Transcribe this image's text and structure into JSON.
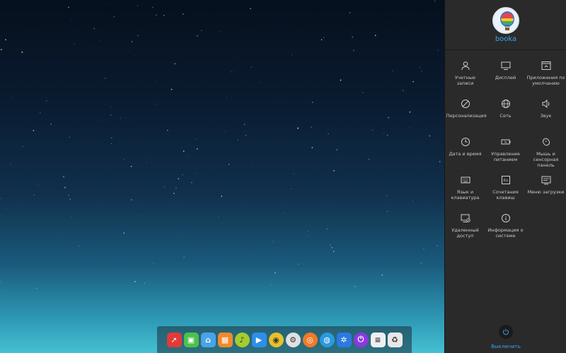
{
  "user": {
    "name": "booka"
  },
  "settings_items": [
    {
      "id": "accounts",
      "label": "Учетные записи",
      "icon": "user-icon"
    },
    {
      "id": "display",
      "label": "Дисплей",
      "icon": "monitor-icon"
    },
    {
      "id": "default-apps",
      "label": "Приложения по умолчанию",
      "icon": "default-apps-icon"
    },
    {
      "id": "personalization",
      "label": "Персонализация",
      "icon": "palette-icon"
    },
    {
      "id": "network",
      "label": "Сеть",
      "icon": "globe-icon"
    },
    {
      "id": "sound",
      "label": "Звук",
      "icon": "speaker-icon"
    },
    {
      "id": "datetime",
      "label": "Дата и время",
      "icon": "clock-icon"
    },
    {
      "id": "power",
      "label": "Управление питанием",
      "icon": "battery-icon"
    },
    {
      "id": "mouse",
      "label": "Мышь и сенсорная панель",
      "icon": "mouse-icon"
    },
    {
      "id": "keyboard",
      "label": "Язык и клавиатура",
      "icon": "keyboard-icon"
    },
    {
      "id": "shortcuts",
      "label": "Сочетания клавиш",
      "icon": "fn-key-icon"
    },
    {
      "id": "boot",
      "label": "Меню загрузки",
      "icon": "boot-menu-icon"
    },
    {
      "id": "remote",
      "label": "Удаленный доступ",
      "icon": "remote-desktop-icon"
    },
    {
      "id": "sysinfo",
      "label": "Информация о системе",
      "icon": "info-icon"
    }
  ],
  "power": {
    "label": "Выключить",
    "icon": "power-icon"
  },
  "dock": [
    {
      "name": "launcher-rocket-icon",
      "color": "#e23a3a"
    },
    {
      "name": "software-center-icon",
      "color": "#4cc14c"
    },
    {
      "name": "file-manager-icon",
      "color": "#4aa3e6"
    },
    {
      "name": "store-bag-icon",
      "color": "#f08a2a"
    },
    {
      "name": "music-player-icon",
      "color": "#a3cc2f"
    },
    {
      "name": "video-player-icon",
      "color": "#2f8fe6"
    },
    {
      "name": "chrome-icon",
      "color": "#e8c12a"
    },
    {
      "name": "settings-gear-icon",
      "color": "#e0e0e0"
    },
    {
      "name": "screenshot-icon",
      "color": "#f07a2a"
    },
    {
      "name": "browser-globe-icon",
      "color": "#2a9ae0"
    },
    {
      "name": "system-monitor-icon",
      "color": "#2a7ae0"
    },
    {
      "name": "shutdown-icon",
      "color": "#8a3ae0"
    },
    {
      "name": "equalizer-icon",
      "color": "#f0f0f0"
    },
    {
      "name": "trash-icon",
      "color": "#e8e8e8"
    }
  ]
}
